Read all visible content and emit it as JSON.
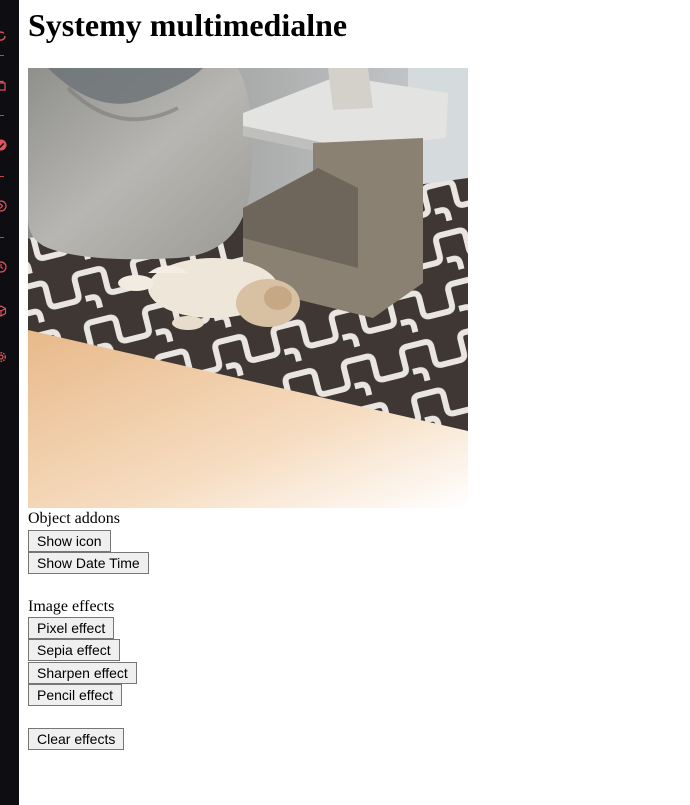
{
  "page": {
    "title": "Systemy multimedialne"
  },
  "camera": {
    "icon": "camera-preview"
  },
  "object_addons": {
    "label": "Object addons",
    "buttons": [
      {
        "label": "Show icon"
      },
      {
        "label": "Show Date Time"
      }
    ]
  },
  "image_effects": {
    "label": "Image effects",
    "buttons": [
      {
        "label": "Pixel effect"
      },
      {
        "label": "Sepia effect"
      },
      {
        "label": "Sharpen effect"
      },
      {
        "label": "Pencil effect"
      }
    ]
  },
  "clear": {
    "label": "Clear effects"
  },
  "side_panel": {
    "icons": [
      "refresh-icon",
      "bag-icon",
      "check-icon",
      "arrow-circle-icon",
      "clock-icon",
      "cube-icon",
      "gear-icon"
    ],
    "accent_color": "#e0555d",
    "background": "#0e0e12"
  }
}
